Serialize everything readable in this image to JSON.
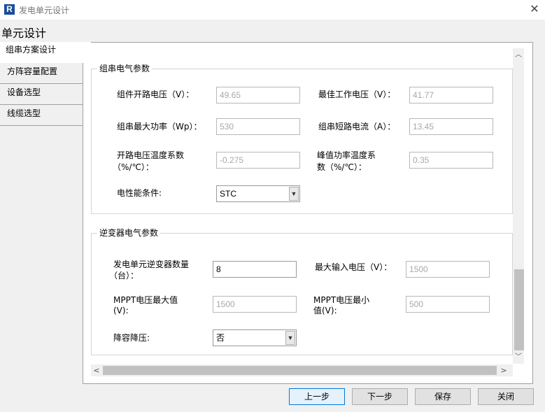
{
  "window": {
    "icon_letter": "R",
    "title": "发电单元设计",
    "close_glyph": "✕"
  },
  "page_title": "单元设计",
  "nav": {
    "items": [
      {
        "label": "组串方案设计",
        "active": true
      },
      {
        "label": "方阵容量配置",
        "active": false
      },
      {
        "label": "设备选型",
        "active": false
      },
      {
        "label": "线缆选型",
        "active": false
      }
    ]
  },
  "string_group": {
    "title": "组串电气参数",
    "open_voltage": {
      "label": "组件开路电压（V）：",
      "value": "49.65"
    },
    "best_voltage": {
      "label": "最佳工作电压（V）：",
      "value": "41.77"
    },
    "max_power": {
      "label": "组串最大功率（Wp）：",
      "value": "530"
    },
    "short_current": {
      "label": "组串短路电流（A）：",
      "value": "13.45"
    },
    "voc_temp_coef": {
      "label_line1": "开路电压温度系数",
      "label_line2": "（%/℃）：",
      "value": "-0.275"
    },
    "pmax_temp_coef": {
      "label_line1": "峰值功率温度系",
      "label_line2": "数（%/℃）：",
      "value": "0.35"
    },
    "condition": {
      "label": "电性能条件:",
      "value": "STC"
    }
  },
  "inverter_group": {
    "title": "逆变器电气参数",
    "count": {
      "label_line1": "发电单元逆变器数量",
      "label_line2": "（台）：",
      "value": "8"
    },
    "max_input_voltage": {
      "label": "最大输入电压（V）：",
      "value": "1500"
    },
    "mppt_max": {
      "label_line1": "MPPT电压最大值",
      "label_line2": "(V):",
      "value": "1500"
    },
    "mppt_min": {
      "label_line1": "MPPT电压最小",
      "label_line2": "值(V):",
      "value": "500"
    },
    "derating": {
      "label": "降容降压:",
      "value": "否"
    }
  },
  "scroll": {
    "up_glyph": "︿",
    "down_glyph": "﹀",
    "left_glyph": "<",
    "right_glyph": ">"
  },
  "buttons": {
    "prev": "上一步",
    "next": "下一步",
    "save": "保存",
    "close": "关闭"
  },
  "colors": {
    "accent": "#0078d7",
    "disabled_text": "#a8a8a8"
  }
}
